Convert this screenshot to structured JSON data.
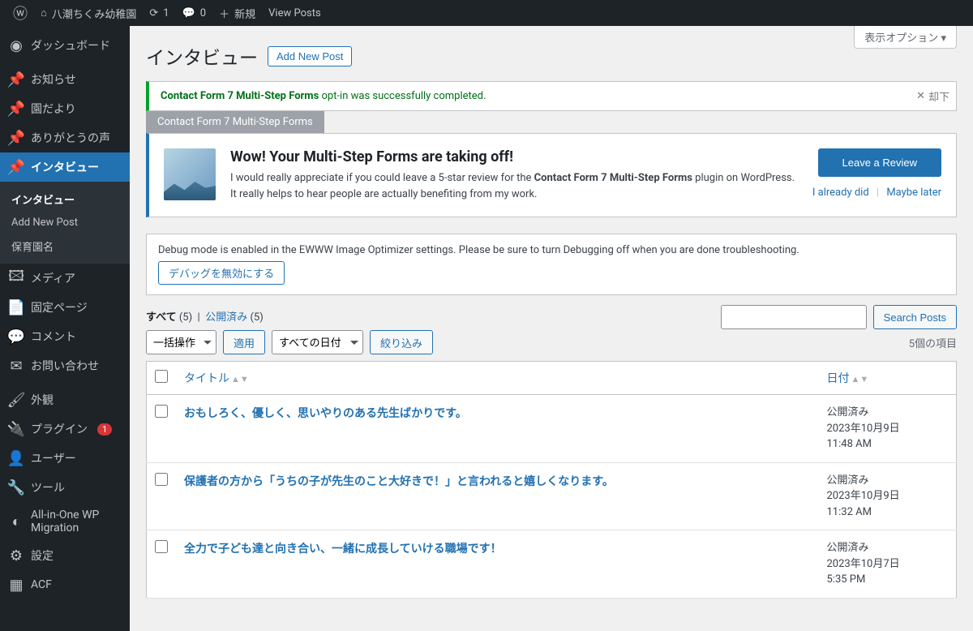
{
  "adminbar": {
    "site_name": "八潮ちくみ幼稚園",
    "refresh_count": "1",
    "comment_count": "0",
    "new_label": "新規",
    "view_posts": "View Posts"
  },
  "sidebar": {
    "items": [
      {
        "label": "ダッシュボード",
        "icon": "⌂"
      },
      {
        "label": "お知らせ",
        "icon": "📌"
      },
      {
        "label": "園だより",
        "icon": "📌"
      },
      {
        "label": "ありがとうの声",
        "icon": "📌"
      },
      {
        "label": "インタビュー",
        "icon": "📌"
      },
      {
        "label": "メディア",
        "icon": "🖼"
      },
      {
        "label": "固定ページ",
        "icon": "📄"
      },
      {
        "label": "コメント",
        "icon": "💬"
      },
      {
        "label": "お問い合わせ",
        "icon": "✉"
      },
      {
        "label": "外観",
        "icon": "🖌"
      },
      {
        "label": "プラグイン",
        "icon": "🔌",
        "badge": "1"
      },
      {
        "label": "ユーザー",
        "icon": "👤"
      },
      {
        "label": "ツール",
        "icon": "🔧"
      },
      {
        "label": "All-in-One WP Migration",
        "icon": "◐"
      },
      {
        "label": "設定",
        "icon": "⚙"
      },
      {
        "label": "ACF",
        "icon": "▦"
      }
    ],
    "submenu": [
      {
        "label": "インタビュー"
      },
      {
        "label": "Add New Post"
      },
      {
        "label": "保育園名"
      }
    ]
  },
  "page": {
    "title": "インタビュー",
    "add_new": "Add New Post",
    "screen_options": "表示オプション"
  },
  "success_notice": {
    "strong": "Contact Form 7 Multi-Step Forms",
    "text": " opt-in was successfully completed.",
    "dismiss": "却下"
  },
  "tag_label": "Contact Form 7 Multi-Step Forms",
  "review": {
    "heading": "Wow! Your Multi-Step Forms are taking off!",
    "text_before": "I would really appreciate if you could leave a 5-star review for the ",
    "text_bold": "Contact Form 7 Multi-Step Forms",
    "text_after": " plugin on WordPress. It really helps to hear people are actually benefiting from my work.",
    "button": "Leave a Review",
    "already": "I already did",
    "later": "Maybe later"
  },
  "debug": {
    "text": "Debug mode is enabled in the EWWW Image Optimizer settings. Please be sure to turn Debugging off when you are done troubleshooting.",
    "button": "デバッグを無効にする"
  },
  "filters": {
    "all_label": "すべて",
    "all_count": "(5)",
    "published_label": "公開済み",
    "published_count": "(5)",
    "search_button": "Search Posts",
    "bulk_action": "一括操作",
    "apply": "適用",
    "all_dates": "すべての日付",
    "filter": "絞り込み",
    "items_count": "5個の項目"
  },
  "table": {
    "col_title": "タイトル",
    "col_date": "日付",
    "rows": [
      {
        "title": "おもしろく、優しく、思いやりのある先生ばかりです。",
        "status": "公開済み",
        "date": "2023年10月9日",
        "time": "11:48 AM"
      },
      {
        "title": "保護者の方から「うちの子が先生のこと大好きで！」と言われると嬉しくなります。",
        "status": "公開済み",
        "date": "2023年10月9日",
        "time": "11:32 AM"
      },
      {
        "title": "全力で子ども達と向き合い、一緒に成長していける職場です！",
        "status": "公開済み",
        "date": "2023年10月7日",
        "time": "5:35 PM"
      }
    ]
  }
}
